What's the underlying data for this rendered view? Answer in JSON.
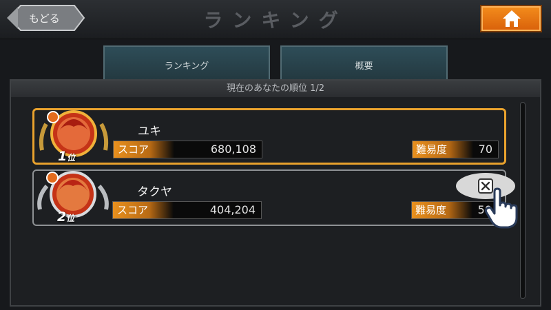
{
  "header": {
    "back_label": "もどる",
    "title": "ランキング"
  },
  "tabs": [
    {
      "label": "ランキング",
      "active": true
    },
    {
      "label": "概要",
      "active": false
    }
  ],
  "panel": {
    "caption": "現在のあなたの順位 1/2"
  },
  "entries": [
    {
      "rank": "1",
      "rank_suffix": "位",
      "name": "ユキ",
      "score_label": "スコア",
      "score": "680,108",
      "difficulty_label": "難易度",
      "difficulty": "70",
      "frame_color": "#e9a22d"
    },
    {
      "rank": "2",
      "rank_suffix": "位",
      "name": "タクヤ",
      "score_label": "スコア",
      "score": "404,204",
      "difficulty_label": "難易度",
      "difficulty": "50",
      "frame_color": "#8e9194"
    }
  ],
  "icons": {
    "home": "home-icon",
    "close": "close-icon",
    "pointer": "hand-pointer-icon"
  },
  "colors": {
    "accent_orange": "#e8901e",
    "gold_frame": "#e9a22d"
  }
}
